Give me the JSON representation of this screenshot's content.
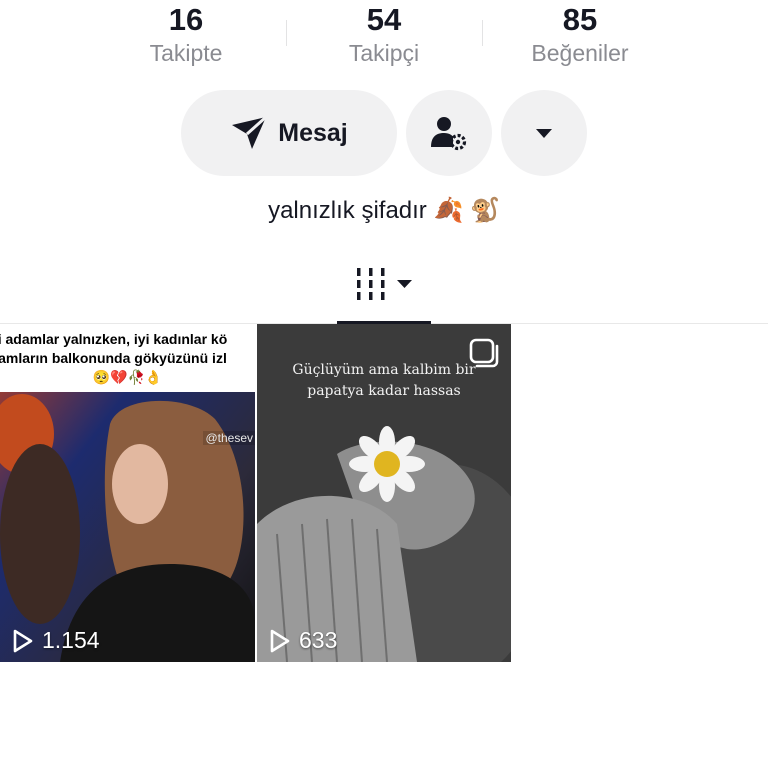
{
  "stats": [
    {
      "value": "16",
      "label": "Takipte"
    },
    {
      "value": "54",
      "label": "Takipçi"
    },
    {
      "value": "85",
      "label": "Beğeniler"
    }
  ],
  "actions": {
    "message_label": "Mesaj",
    "send_icon": "send-icon",
    "friend_icon": "user-settings-icon",
    "more_icon": "caret-down-icon"
  },
  "bio": "yalnızlık şifadır 🍂 🐒",
  "tabs": {
    "active_icon": "grid-icon"
  },
  "videos": [
    {
      "caption_lines": [
        "i adamlar yalnızken, iyi kadınlar kö",
        "amların balkonunda gökyüzünü izl",
        "🥺💔🥀👌"
      ],
      "watermark": "@thesev",
      "views": "1.154"
    },
    {
      "caption_lines": [
        "Güçlüyüm ama kalbim bir",
        "papatya kadar hassas"
      ],
      "views": "633",
      "badge_icon": "multi-photo-icon"
    }
  ],
  "colors": {
    "text": "#161823",
    "secondary": "#8a8b91",
    "button_bg": "#f1f1f2"
  }
}
